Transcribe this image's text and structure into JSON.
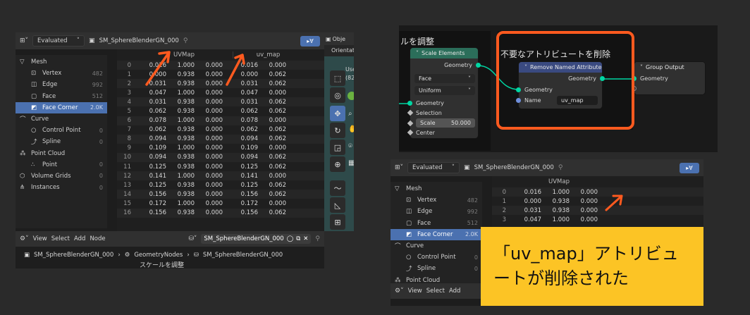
{
  "left": {
    "header": {
      "mode": "Evaluated",
      "object": "SM_SphereBlenderGN_000",
      "pin_icon": "pin-icon",
      "filter_icon": "filter-icon"
    },
    "tree": [
      {
        "label": "Mesh",
        "count": "",
        "icon": "mesh-icon",
        "indent": 0
      },
      {
        "label": "Vertex",
        "count": "482",
        "icon": "vertex-icon",
        "indent": 1
      },
      {
        "label": "Edge",
        "count": "992",
        "icon": "edge-icon",
        "indent": 1
      },
      {
        "label": "Face",
        "count": "512",
        "icon": "face-icon",
        "indent": 1
      },
      {
        "label": "Face Corner",
        "count": "2.0K",
        "icon": "face-corner-icon",
        "indent": 1,
        "selected": true
      },
      {
        "label": "Curve",
        "count": "",
        "icon": "curve-icon",
        "indent": 0
      },
      {
        "label": "Control Point",
        "count": "0",
        "icon": "control-point-icon",
        "indent": 1
      },
      {
        "label": "Spline",
        "count": "0",
        "icon": "spline-icon",
        "indent": 1
      },
      {
        "label": "Point Cloud",
        "count": "",
        "icon": "point-cloud-icon",
        "indent": 0
      },
      {
        "label": "Point",
        "count": "0",
        "icon": "point-icon",
        "indent": 1
      },
      {
        "label": "Volume Grids",
        "count": "0",
        "icon": "volume-icon",
        "indent": 0
      },
      {
        "label": "Instances",
        "count": "0",
        "icon": "instances-icon",
        "indent": 0
      }
    ],
    "columns": [
      "UVMap",
      "uv_map"
    ],
    "rows": [
      [
        "0",
        "0.016",
        "1.000",
        "0.000",
        "0.016",
        "0.000"
      ],
      [
        "1",
        "0.000",
        "0.938",
        "0.000",
        "0.000",
        "0.062"
      ],
      [
        "2",
        "0.031",
        "0.938",
        "0.000",
        "0.031",
        "0.062"
      ],
      [
        "3",
        "0.047",
        "1.000",
        "0.000",
        "0.047",
        "0.000"
      ],
      [
        "4",
        "0.031",
        "0.938",
        "0.000",
        "0.031",
        "0.062"
      ],
      [
        "5",
        "0.062",
        "0.938",
        "0.000",
        "0.062",
        "0.062"
      ],
      [
        "6",
        "0.078",
        "1.000",
        "0.000",
        "0.078",
        "0.000"
      ],
      [
        "7",
        "0.062",
        "0.938",
        "0.000",
        "0.062",
        "0.062"
      ],
      [
        "8",
        "0.094",
        "0.938",
        "0.000",
        "0.094",
        "0.062"
      ],
      [
        "9",
        "0.109",
        "1.000",
        "0.000",
        "0.109",
        "0.000"
      ],
      [
        "10",
        "0.094",
        "0.938",
        "0.000",
        "0.094",
        "0.062"
      ],
      [
        "11",
        "0.125",
        "0.938",
        "0.000",
        "0.125",
        "0.062"
      ],
      [
        "12",
        "0.141",
        "1.000",
        "0.000",
        "0.141",
        "0.000"
      ],
      [
        "13",
        "0.125",
        "0.938",
        "0.000",
        "0.125",
        "0.062"
      ],
      [
        "14",
        "0.156",
        "0.938",
        "0.000",
        "0.156",
        "0.062"
      ],
      [
        "15",
        "0.172",
        "1.000",
        "0.000",
        "0.172",
        "0.000"
      ],
      [
        "16",
        "0.156",
        "0.938",
        "0.000",
        "0.156",
        "0.062"
      ]
    ],
    "viewport": {
      "header_label": "Obje",
      "orientation": "Orientatio",
      "user_label": "User",
      "user_sub": "(82)"
    },
    "node_header": {
      "menus": [
        "View",
        "Select",
        "Add",
        "Node"
      ],
      "tree_name": "SM_SphereBlenderGN_000"
    },
    "breadcrumb": {
      "object": "SM_SphereBlenderGN_000",
      "modifier": "GeometryNodes",
      "tree": "SM_SphereBlenderGN_000",
      "frame_label": "スケールを調整"
    }
  },
  "node_editor": {
    "frame1_label": "ルを調整",
    "frame2_label": "不要なアトリビュートを削除",
    "scale_node": {
      "title": "Scale Elements",
      "output": "Geometry",
      "domain": "Face",
      "mode": "Uniform",
      "inputs": [
        "Geometry",
        "Selection",
        "Center"
      ],
      "scale_label": "Scale",
      "scale_value": "50.000"
    },
    "remove_node": {
      "title": "Remove Named Attribute",
      "output": "Geometry",
      "input": "Geometry",
      "name_label": "Name",
      "name_value": "uv_map"
    },
    "output_node": {
      "title": "Group Output",
      "input": "Geometry"
    }
  },
  "right": {
    "header": {
      "mode": "Evaluated",
      "object": "SM_SphereBlenderGN_000"
    },
    "tree": [
      {
        "label": "Mesh",
        "count": "",
        "icon": "mesh-icon",
        "indent": 0
      },
      {
        "label": "Vertex",
        "count": "482",
        "icon": "vertex-icon",
        "indent": 1
      },
      {
        "label": "Edge",
        "count": "992",
        "icon": "edge-icon",
        "indent": 1
      },
      {
        "label": "Face",
        "count": "512",
        "icon": "face-icon",
        "indent": 1
      },
      {
        "label": "Face Corner",
        "count": "2.0K",
        "icon": "face-corner-icon",
        "indent": 1,
        "selected": true
      },
      {
        "label": "Curve",
        "count": "",
        "icon": "curve-icon",
        "indent": 0
      },
      {
        "label": "Control Point",
        "count": "0",
        "icon": "control-point-icon",
        "indent": 1
      },
      {
        "label": "Spline",
        "count": "0",
        "icon": "spline-icon",
        "indent": 1
      },
      {
        "label": "Point Cloud",
        "count": "",
        "icon": "point-cloud-icon",
        "indent": 0
      }
    ],
    "columns": [
      "UVMap"
    ],
    "rows": [
      [
        "0",
        "0.016",
        "1.000",
        "0.000"
      ],
      [
        "1",
        "0.000",
        "0.938",
        "0.000"
      ],
      [
        "2",
        "0.031",
        "0.938",
        "0.000"
      ],
      [
        "3",
        "0.047",
        "1.000",
        "0.000"
      ]
    ],
    "menus": [
      "View",
      "Select",
      "Add"
    ],
    "callout": "「uv_map」アトリビュートが削除された"
  },
  "colors": {
    "accent": "#ff5a1f",
    "callout_bg": "#fcc425",
    "selected": "#4b71b0",
    "socket_geo": "#00d6a3",
    "socket_val": "#6f8fdc"
  }
}
